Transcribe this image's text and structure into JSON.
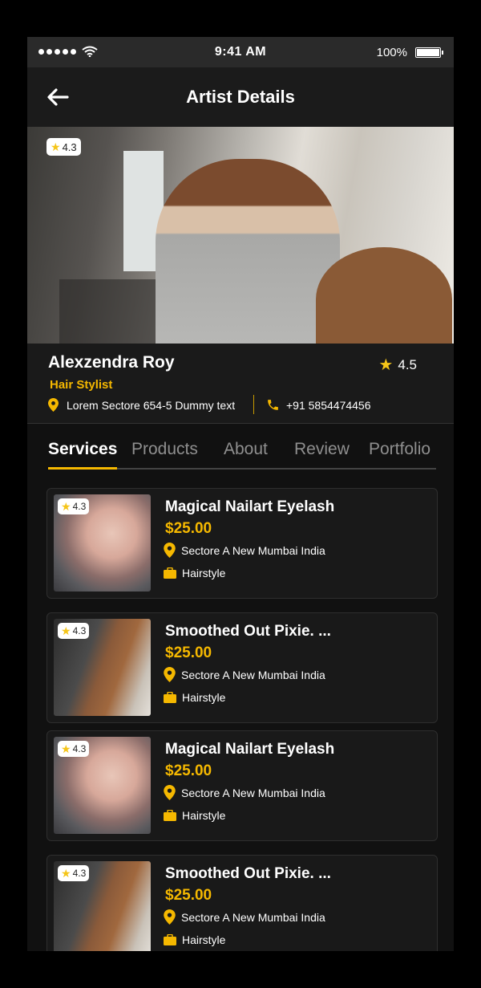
{
  "status_bar": {
    "time": "9:41 AM",
    "battery": "100%"
  },
  "header": {
    "title": "Artist Details"
  },
  "hero": {
    "rating": "4.3"
  },
  "artist": {
    "name": "Alexzendra Roy",
    "role": "Hair Stylist",
    "rating": "4.5",
    "address": "Lorem Sectore 654-5 Dummy text",
    "phone": "+91 5854474456"
  },
  "tabs": [
    {
      "label": "Services",
      "active": true
    },
    {
      "label": "Products",
      "active": false
    },
    {
      "label": "About",
      "active": false
    },
    {
      "label": "Review",
      "active": false
    },
    {
      "label": "Portfolio",
      "active": false
    }
  ],
  "services": [
    {
      "title": "Magical Nailart Eyelash",
      "price": "$25.00",
      "location": "Sectore A New Mumbai India",
      "category": "Hairstyle",
      "rating": "4.3"
    },
    {
      "title": "Smoothed Out Pixie. ...",
      "price": "$25.00",
      "location": "Sectore A New Mumbai India",
      "category": "Hairstyle",
      "rating": "4.3"
    },
    {
      "title": "Magical Nailart Eyelash",
      "price": "$25.00",
      "location": "Sectore A New Mumbai India",
      "category": "Hairstyle",
      "rating": "4.3"
    },
    {
      "title": "Smoothed Out Pixie. ...",
      "price": "$25.00",
      "location": "Sectore A New Mumbai India",
      "category": "Hairstyle",
      "rating": "4.3"
    }
  ],
  "colors": {
    "accent": "#f5b800",
    "background": "#111111",
    "card": "#191919"
  },
  "icons": [
    "back-arrow-icon",
    "star-icon",
    "location-pin-icon",
    "phone-icon",
    "briefcase-icon",
    "wifi-icon",
    "battery-icon"
  ]
}
